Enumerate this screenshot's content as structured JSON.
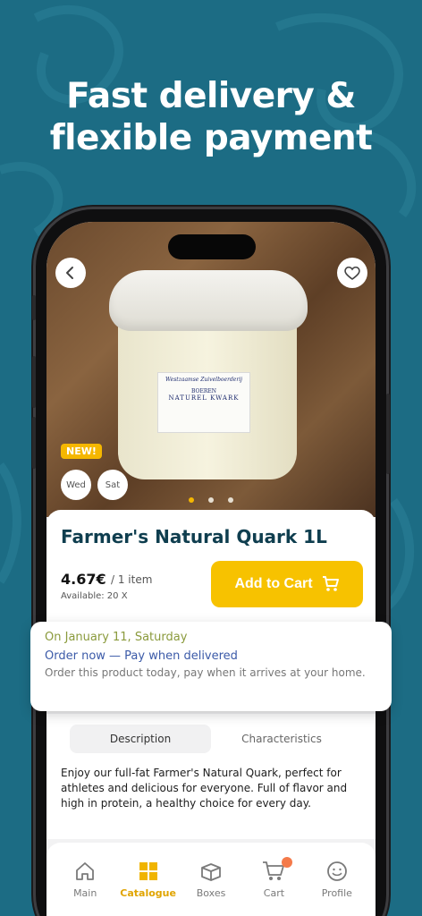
{
  "promo": {
    "headline_line1": "Fast delivery &",
    "headline_line2": "flexible payment"
  },
  "product": {
    "badge": "NEW!",
    "days": [
      "Wed",
      "Sat"
    ],
    "title": "Farmer's Natural Quark 1L",
    "price": "4.67€",
    "per_unit": "/ 1 item",
    "available": "Available: 20 X",
    "add_to_cart": "Add to Cart",
    "photo_label": {
      "brand": "Westzaamse Zuivelboerderij",
      "line1": "BOEREN",
      "line2": "NATUREL KWARK"
    }
  },
  "delivery_popup": {
    "date": "On January 11, Saturday",
    "order": "Order now — Pay when delivered",
    "description": "Order this product today, pay when it arrives at your home."
  },
  "detail_tabs": [
    "Description",
    "Characteristics"
  ],
  "description_text": "Enjoy our full-fat Farmer's Natural Quark, perfect for athletes and delicious for everyone. Full of flavor and high in protein, a healthy choice for every day.",
  "tabbar": [
    {
      "label": "Main",
      "icon": "home-icon"
    },
    {
      "label": "Catalogue",
      "icon": "grid-icon"
    },
    {
      "label": "Boxes",
      "icon": "box-icon"
    },
    {
      "label": "Cart",
      "icon": "cart-icon"
    },
    {
      "label": "Profile",
      "icon": "smiley-icon"
    }
  ],
  "colors": {
    "background": "#1c6c84",
    "accent": "#f7c200",
    "title": "#0f3e4f",
    "link": "#3b5aa8",
    "date": "#8a9a3c"
  }
}
